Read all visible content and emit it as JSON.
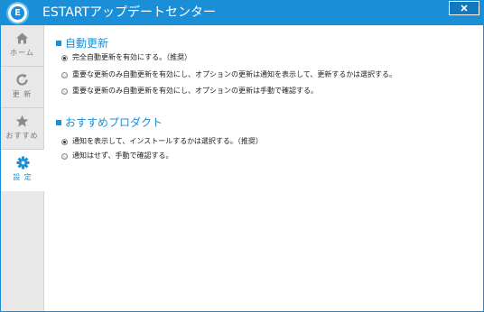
{
  "window": {
    "title": "ESTARTアップデートセンター",
    "logo_letter": "E",
    "close_icon": "close-icon"
  },
  "colors": {
    "accent": "#1a8fd8",
    "sidebar_bg": "#e8e8e8",
    "text": "#222222"
  },
  "sidebar": {
    "items": [
      {
        "label": "ホーム",
        "icon": "home-icon",
        "active": false
      },
      {
        "label": "更 新",
        "icon": "refresh-icon",
        "active": false
      },
      {
        "label": "おすすめ",
        "icon": "star-icon",
        "active": false
      },
      {
        "label": "設 定",
        "icon": "gear-icon",
        "active": true
      }
    ]
  },
  "settings": {
    "auto_update": {
      "title": "自動更新",
      "selected_index": 0,
      "options": [
        "完全自動更新を有効にする。（推奨）",
        "重要な更新のみ自動更新を有効にし、オプションの更新は通知を表示して、更新するかは選択する。",
        "重要な更新のみ自動更新を有効にし、オプションの更新は手動で確認する。"
      ]
    },
    "recommended_products": {
      "title": "おすすめプロダクト",
      "selected_index": 0,
      "options": [
        "通知を表示して、インストールするかは選択する。（推奨）",
        "通知はせず、手動で確認する。"
      ]
    }
  }
}
